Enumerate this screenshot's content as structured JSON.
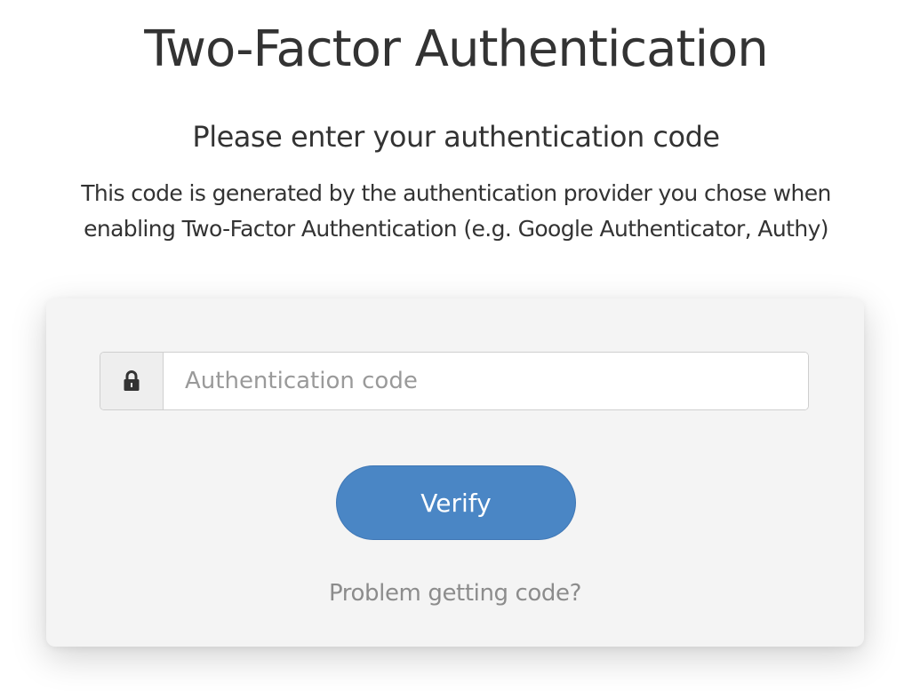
{
  "page": {
    "title": "Two-Factor Authentication",
    "subtitle": "Please enter your authentication code",
    "description_line1": "This code is generated by the authentication provider you chose when",
    "description_line2": "enabling Two-Factor Authentication (e.g. Google Authenticator, Authy)"
  },
  "form": {
    "input_icon": "lock-icon",
    "input_placeholder": "Authentication code",
    "input_value": "",
    "verify_label": "Verify",
    "problem_link": "Problem getting code?"
  },
  "colors": {
    "primary_button": "#4a86c5",
    "card_background": "#f4f4f4",
    "link_text": "#8c8c8c"
  }
}
